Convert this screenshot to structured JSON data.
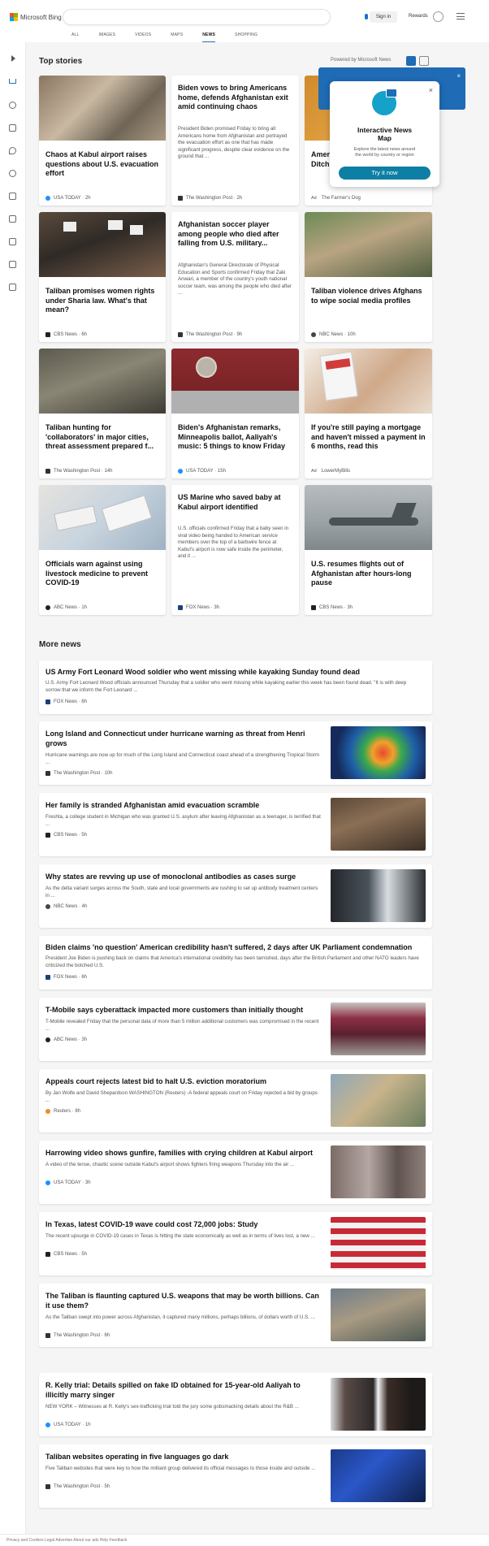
{
  "header": {
    "logo_text": "Microsoft Bing",
    "search_placeholder": "",
    "signin_label": "Sign in",
    "rewards_label": "Rewards"
  },
  "tabs": [
    {
      "label": "ALL"
    },
    {
      "label": "IMAGES"
    },
    {
      "label": "VIDEOS"
    },
    {
      "label": "MAPS"
    },
    {
      "label": "NEWS"
    },
    {
      "label": "SHOPPING"
    }
  ],
  "top_stories": {
    "title": "Top stories",
    "powered_by": "Powered by Microsoft News"
  },
  "popup": {
    "title_line1": "Interactive News",
    "title_line2": "Map",
    "desc_line1": "Explore the latest news around",
    "desc_line2": "the world by country or region",
    "button": "Try it now"
  },
  "cards": [
    {
      "title": "Chaos at Kabul airport raises questions about U.S. evacuation effort",
      "source": "USA TODAY · 2h",
      "desc": ""
    },
    {
      "title": "Biden vows to bring Americans home, defends Afghanistan exit amid continuing chaos",
      "desc": "President Biden promised Friday to bring all Americans home from Afghanistan and portrayed the evacuation effort as one that has made significant progress, despite clear evidence on the ground that ...",
      "source": "The Washington Post · 2h"
    },
    {
      "title": "Amer... Ditch...",
      "source": "The Farmer's Dog",
      "ad": "Ad",
      "desc": ""
    },
    {
      "title": "Taliban promises women rights under Sharia law. What's that mean?",
      "source": "CBS News · 6h",
      "desc": ""
    },
    {
      "title": "Afghanistan soccer player among people who died after falling from U.S. military...",
      "desc": "Afghanistan's General Directorate of Physical Education and Sports confirmed Friday that Zaki Anwari, a member of the country's youth national soccer team, was among the people who died after ...",
      "source": "The Washington Post · 9h"
    },
    {
      "title": "Taliban violence drives Afghans to wipe social media profiles",
      "source": "NBC News · 10h",
      "desc": ""
    },
    {
      "title": "Taliban hunting for 'collaborators' in major cities, threat assessment prepared f...",
      "source": "The Washington Post · 14h",
      "desc": ""
    },
    {
      "title": "Biden's Afghanistan remarks, Minneapolis ballot, Aaliyah's music: 5 things to know Friday",
      "source": "USA TODAY · 15h",
      "desc": ""
    },
    {
      "title": "If you're still paying a mortgage and haven't missed a payment in 6 months, read this",
      "source": "LowerMyBills",
      "ad": "Ad",
      "desc": ""
    },
    {
      "title": "Officials warn against using livestock medicine to prevent COVID-19",
      "source": "ABC News · 1h",
      "desc": ""
    },
    {
      "title": "US Marine who saved baby at Kabul airport identified",
      "desc": "U.S. officials confirmed Friday that a baby seen in viral video being handed to American service members over the top of a barbwire fence at Kabul's airport is now safe inside the perimeter, and it ...",
      "source": "FOX News · 3h"
    },
    {
      "title": "U.S. resumes flights out of Afghanistan after hours-long pause",
      "source": "CBS News · 3h",
      "desc": ""
    }
  ],
  "more_news": {
    "title": "More news",
    "items": [
      {
        "title": "US Army Fort Leonard Wood soldier who went missing while kayaking Sunday found dead",
        "desc": "U.S. Army Fort Leonard Wood officials announced Thursday that a soldier who went missing while kayaking earlier this week has been found dead. \"It is with deep sorrow that we inform the Fort Leonard ...",
        "source": "FOX News · 6h"
      },
      {
        "title": "Long Island and Connecticut under hurricane warning as threat from Henri grows",
        "desc": "Hurricane warnings are now up for much of the Long Island and Connecticut coast ahead of a strengthening Tropical Storm ...",
        "source": "The Washington Post · 10h"
      },
      {
        "title": "Her family is stranded Afghanistan amid evacuation scramble",
        "desc": "Freshta, a college student in Michigan who was granted U.S. asylum after leaving Afghanistan as a teenager, is terrified that ...",
        "source": "CBS News · 5h"
      },
      {
        "title": "Why states are revving up use of monoclonal antibodies as cases surge",
        "desc": "As the delta variant surges across the South, state and local governments are rushing to set up antibody treatment centers in ...",
        "source": "NBC News · 4h"
      },
      {
        "title": "Biden claims 'no question' American credibility hasn't suffered, 2 days after UK Parliament condemnation",
        "desc": "President Joe Biden is pushing back on claims that America's international credibility has been tarnished, days after the British Parliament and other NATO leaders have criticized the botched U.S.",
        "source": "FOX News · 6h"
      },
      {
        "title": "T-Mobile says cyberattack impacted more customers than initially thought",
        "desc": "T-Mobile revealed Friday that the personal data of more than 5 million additional customers was compromised in the recent ...",
        "source": "ABC News · 3h"
      },
      {
        "title": "Appeals court rejects latest bid to halt U.S. eviction moratorium",
        "desc": "By Jan Wolfe and David Shepardson WASHINGTON (Reuters) -A federal appeals court on Friday rejected a bid by groups ...",
        "source": "Reuters · 8h"
      },
      {
        "title": "Harrowing video shows gunfire, families with crying children at Kabul airport",
        "desc": "A video of the tense, chaotic scene outside Kabul's airport shows fighters firing weapons Thursday into the air ...",
        "source": "USA TODAY · 3h"
      },
      {
        "title": "In Texas, latest COVID-19 wave could cost 72,000 jobs: Study",
        "desc": "The recent upsurge in COVID-19 cases in Texas is hitting the state economically as well as in terms of lives lost, a new ...",
        "source": "CBS News · 5h"
      },
      {
        "title": "The Taliban is flaunting captured U.S. weapons that may be worth billions. Can it use them?",
        "desc": "As the Taliban swept into power across Afghanistan, it captured many millions, perhaps billions, of dollars worth of U.S. ...",
        "source": "The Washington Post · 6h"
      },
      {
        "title": "R. Kelly trial: Details spilled on fake ID obtained for 15-year-old Aaliyah to illicitly marry singer",
        "desc": "NEW YORK – Witnesses at R. Kelly's sex-trafficking trial told the jury some gobsmacking details about the R&B ...",
        "source": "USA TODAY · 1h"
      },
      {
        "title": "Taliban websites operating in five languages go dark",
        "desc": "Five Taliban websites that were key to how the militant group delivered its official messages to those inside and outside ...",
        "source": "The Washington Post · 5h"
      }
    ]
  },
  "footer": {
    "text": "Privacy and Cookies   Legal   Advertise   About our ads   Help   Feedback"
  },
  "colors": {
    "accent": "#1a73c8",
    "popup_button": "#0e7fa4",
    "map_card": "#1f6bb5"
  }
}
